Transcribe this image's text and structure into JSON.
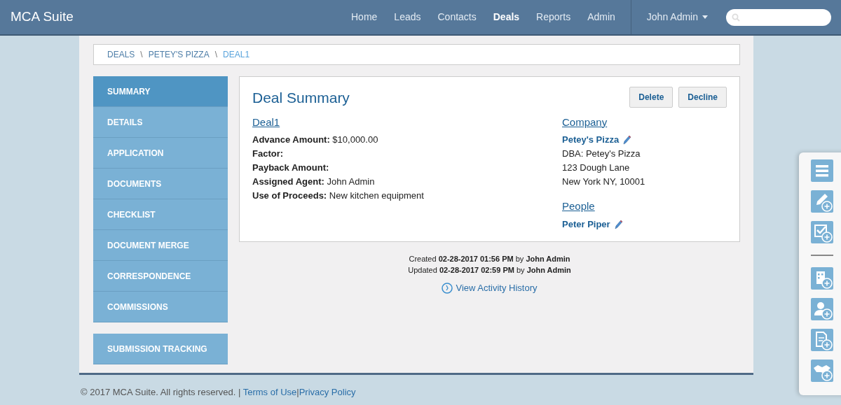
{
  "brand": "MCA Suite",
  "nav": [
    {
      "label": "Home",
      "selected": false
    },
    {
      "label": "Leads",
      "selected": false
    },
    {
      "label": "Contacts",
      "selected": false
    },
    {
      "label": "Deals",
      "selected": true
    },
    {
      "label": "Reports",
      "selected": false
    },
    {
      "label": "Admin",
      "selected": false
    }
  ],
  "user_menu": "John Admin",
  "breadcrumb_separators": [
    "\\",
    "\\"
  ],
  "breadcrumb": [
    {
      "label": "DEALS",
      "selected": false
    },
    {
      "label": "PETEY'S PIZZA",
      "selected": false
    },
    {
      "label": "DEAL1",
      "selected": true
    }
  ],
  "sidebar": {
    "items": [
      {
        "label": "SUMMARY",
        "selected": true
      },
      {
        "label": "DETAILS",
        "selected": false
      },
      {
        "label": "APPLICATION",
        "selected": false
      },
      {
        "label": "DOCUMENTS",
        "selected": false
      },
      {
        "label": "CHECKLIST",
        "selected": false
      },
      {
        "label": "DOCUMENT MERGE",
        "selected": false
      },
      {
        "label": "CORRESPONDENCE",
        "selected": false
      },
      {
        "label": "COMMISSIONS",
        "selected": false
      }
    ],
    "extra": {
      "label": "SUBMISSION TRACKING",
      "selected": false
    }
  },
  "summary": {
    "title": "Deal Summary",
    "buttons": [
      "Delete",
      "Decline"
    ],
    "deal": {
      "heading": "Deal1",
      "fields": [
        "**Advance Amount:** $10,000.00",
        "**Factor:**",
        "**Payback Amount:**",
        "**Assigned Agent:** John Admin",
        "**Use of Proceeds:** New kitchen equipment"
      ]
    },
    "company": {
      "heading": "Company",
      "name": "Petey's Pizza",
      "lines": [
        "DBA: Petey's Pizza",
        "123 Dough Lane",
        "New York NY, 10001"
      ]
    },
    "people": {
      "heading": "People",
      "names": [
        "Peter Piper"
      ]
    }
  },
  "audit": [
    "Created **02-28-2017 01:56 PM** by **John Admin**",
    "Updated **02-28-2017 02:59 PM** by **John Admin**"
  ],
  "activity_link": "View Activity History",
  "footer": {
    "text": "© 2017 MCA Suite. All rights reserved. |",
    "links": [
      "Terms of Use",
      "Privacy Policy"
    ],
    "separator": "|"
  }
}
